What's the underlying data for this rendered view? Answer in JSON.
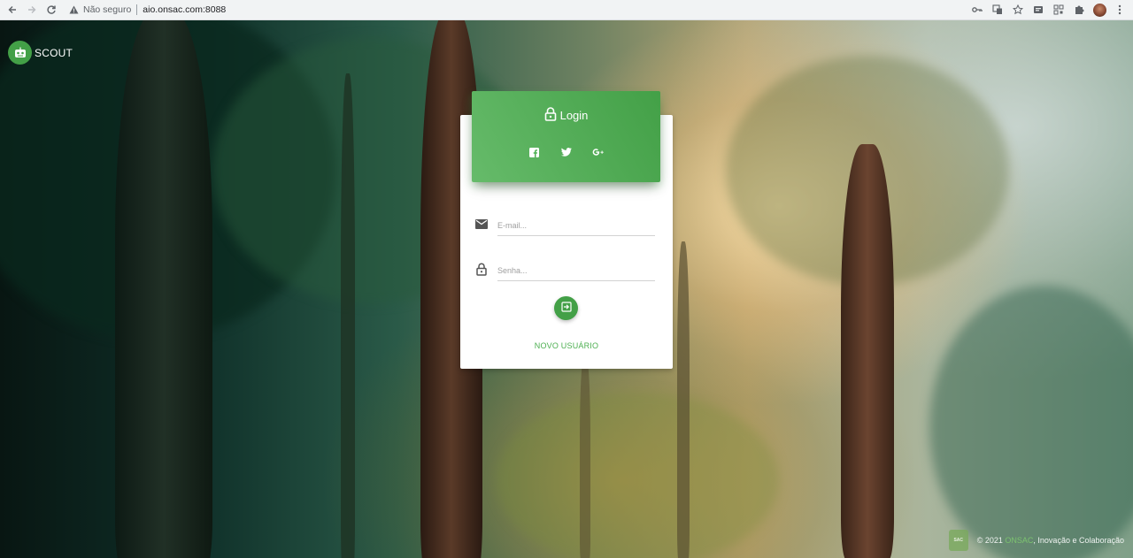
{
  "browser": {
    "security_label": "Não seguro",
    "url": "aio.onsac.com:8088",
    "nav_icons": [
      "back-arrow-icon",
      "forward-arrow-icon",
      "reload-icon"
    ],
    "toolbar_icons": [
      "key-icon",
      "translate-icon",
      "star-icon",
      "cast-icon",
      "grid-icon",
      "puzzle-icon",
      "avatar",
      "more-icon"
    ]
  },
  "brand": {
    "name": "SCOUT",
    "icon": "robot-icon"
  },
  "login": {
    "title": "Login",
    "title_icon": "lock-icon",
    "social": [
      {
        "name": "facebook-icon",
        "glyph": "f"
      },
      {
        "name": "twitter-icon",
        "glyph": ""
      },
      {
        "name": "google-plus-icon",
        "glyph": "G+"
      }
    ],
    "email_placeholder": "E-mail...",
    "password_placeholder": "Senha...",
    "submit_icon": "login-icon",
    "new_user_label": "NOVO USUÁRIO"
  },
  "footer": {
    "copyright": "© 2021",
    "brand": "ONSAC",
    "tagline": ", Inovação e Colaboração",
    "logo_text": "SAC"
  },
  "colors": {
    "accent": "#43a047",
    "accent_light": "#66bb6a",
    "link": "#4caf50"
  }
}
